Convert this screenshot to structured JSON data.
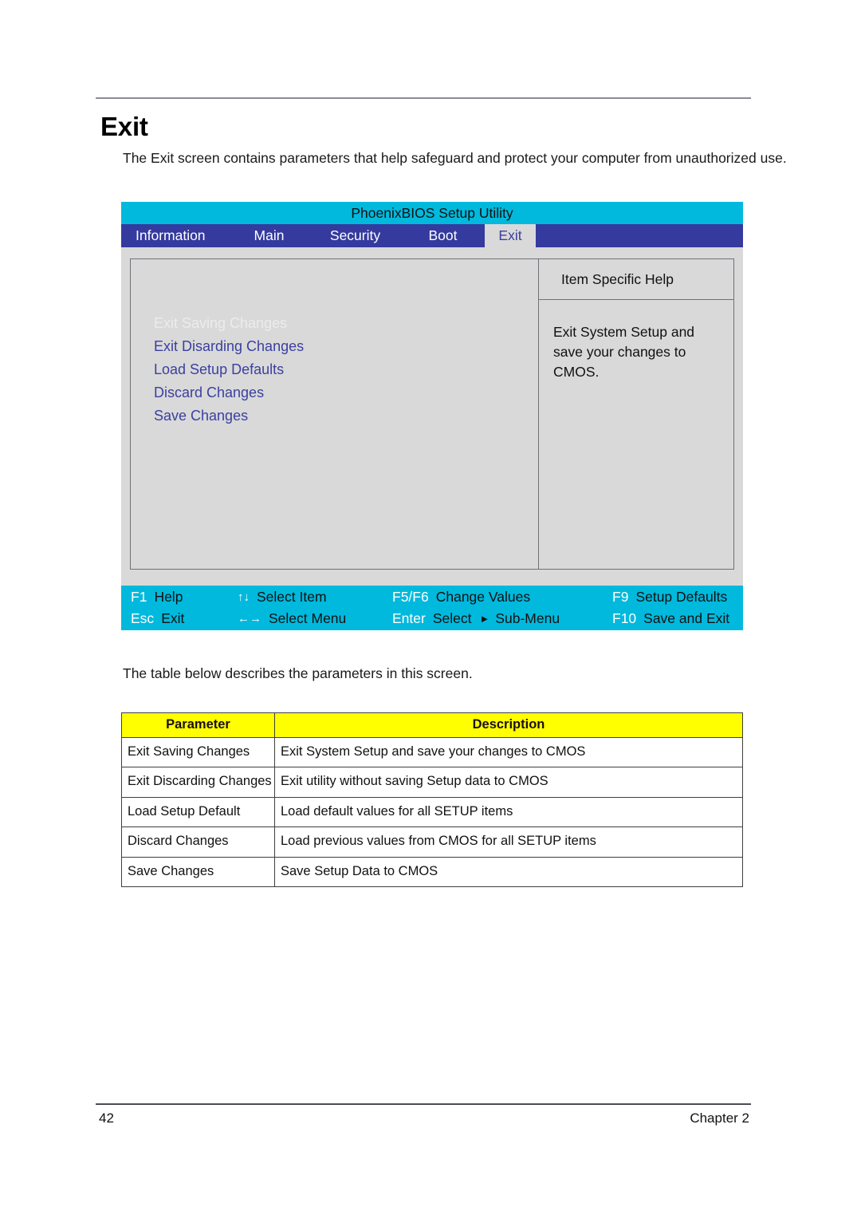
{
  "page": {
    "heading": "Exit",
    "intro": "The Exit screen contains parameters that help safeguard and protect your computer from unauthorized use.",
    "table_intro": "The table below describes the parameters in this screen.",
    "page_number": "42",
    "chapter": "Chapter 2"
  },
  "bios": {
    "title": "PhoenixBIOS Setup Utility",
    "tabs": [
      {
        "label": "Information",
        "active": false
      },
      {
        "label": "Main",
        "active": false
      },
      {
        "label": "Security",
        "active": false
      },
      {
        "label": "Boot",
        "active": false
      },
      {
        "label": "Exit",
        "active": true
      }
    ],
    "menu_items": [
      {
        "label": "Exit Saving Changes",
        "selected": true
      },
      {
        "label": "Exit Disarding Changes",
        "selected": false
      },
      {
        "label": "Load Setup Defaults",
        "selected": false
      },
      {
        "label": "Discard Changes",
        "selected": false
      },
      {
        "label": "Save Changes",
        "selected": false
      }
    ],
    "help": {
      "header": "Item Specific Help",
      "body": "Exit System Setup and save your changes to CMOS."
    },
    "keys": {
      "row1": [
        {
          "name": "F1",
          "desc": "Help"
        },
        {
          "name": "↑↓",
          "desc": "Select Item"
        },
        {
          "name": "F5/F6",
          "desc": "Change Values"
        },
        {
          "name": "F9",
          "desc": "Setup Defaults"
        }
      ],
      "row2": [
        {
          "name": "Esc",
          "desc": "Exit"
        },
        {
          "name": "←→",
          "desc": "Select Menu"
        },
        {
          "name": "Enter",
          "desc": "Select"
        },
        {
          "name": "F10",
          "desc": "Save and Exit"
        }
      ],
      "submenu_label": "Sub-Menu",
      "submenu_icon": "triangle-right-icon"
    },
    "colors": {
      "titlebar": "#00b9dd",
      "tabbar": "#343a9e",
      "panel": "#d9d9d9",
      "menu_text": "#3b40a0",
      "footer": "#00b9dd"
    }
  },
  "table": {
    "headers": [
      "Parameter",
      "Description"
    ],
    "rows": [
      {
        "parameter": "Exit Saving Changes",
        "description": "Exit System Setup and save your changes to CMOS"
      },
      {
        "parameter": "Exit Discarding Changes",
        "description": "Exit utility without saving Setup data to CMOS"
      },
      {
        "parameter": "Load Setup Default",
        "description": "Load default values for all SETUP items"
      },
      {
        "parameter": "Discard Changes",
        "description": "Load previous values from CMOS for all SETUP items"
      },
      {
        "parameter": "Save Changes",
        "description": "Save Setup Data to CMOS"
      }
    ],
    "header_bg": "#ffff00"
  }
}
